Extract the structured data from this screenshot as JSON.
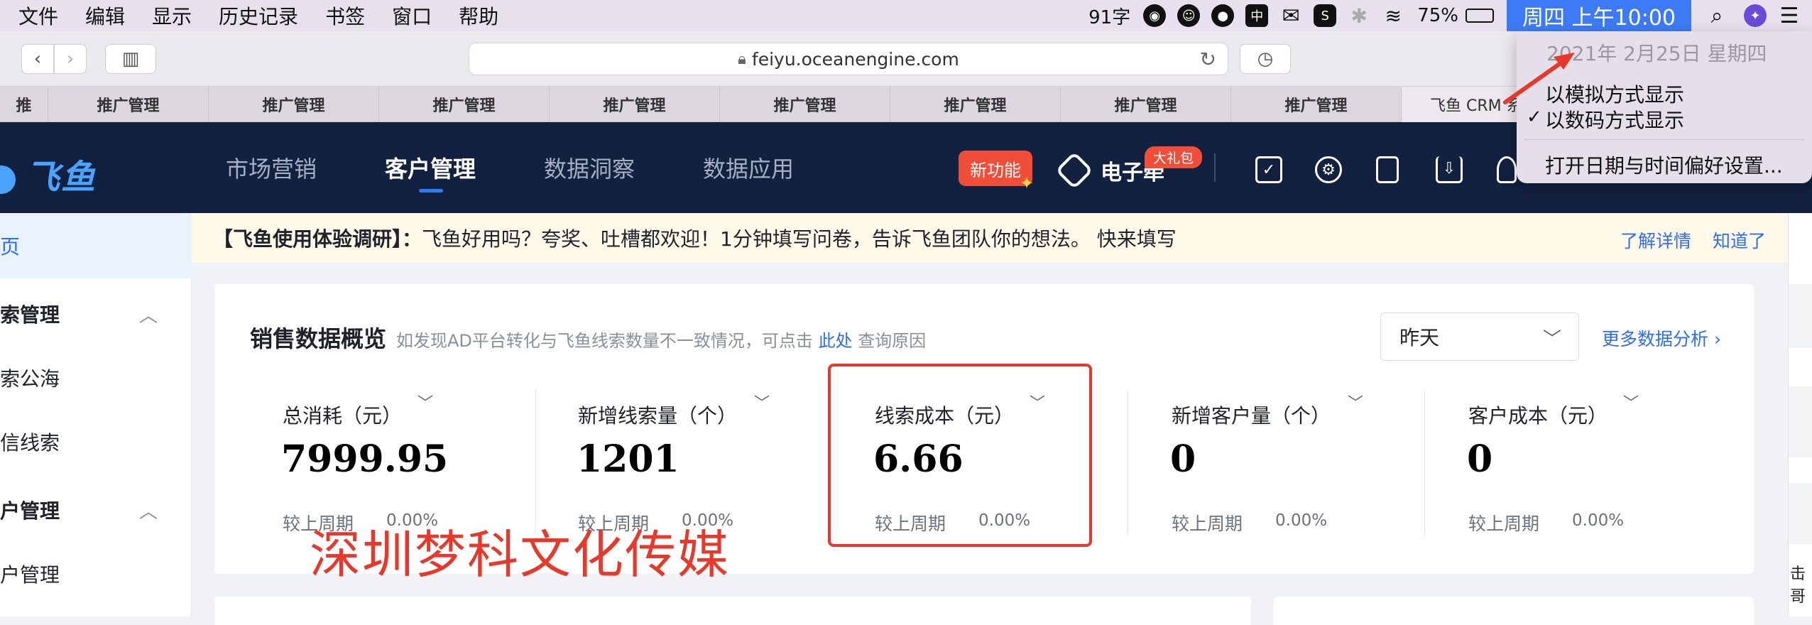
{
  "menubar": {
    "menus": [
      "文件",
      "编辑",
      "显示",
      "历史记录",
      "书签",
      "窗口",
      "帮助"
    ],
    "word_count": "91字",
    "battery": "75%",
    "clock": "周四 上午10:00"
  },
  "browser": {
    "url": "feiyu.oceanengine.com",
    "tabs": [
      "推",
      "推广管理",
      "推广管理",
      "推广管理",
      "推广管理",
      "推广管理",
      "推广管理",
      "推广管理",
      "推广管理",
      "飞鱼 CRM 系"
    ]
  },
  "header": {
    "logo": "飞鱼",
    "nav": [
      "市场营销",
      "客户管理",
      "数据洞察",
      "数据应用"
    ],
    "new_feature": "新功能",
    "esign": "电子牵",
    "gift_badge": "大礼包",
    "icons": [
      "clipboard-icon",
      "gear-icon",
      "tablet-icon",
      "download-icon",
      "bell-icon"
    ]
  },
  "sidebar": {
    "home": "页",
    "items": [
      {
        "label": "索管理",
        "group": true
      },
      {
        "label": "索公海",
        "group": false
      },
      {
        "label": "信线索",
        "group": false
      },
      {
        "label": "户管理",
        "group": true
      },
      {
        "label": "户管理",
        "group": false
      }
    ]
  },
  "notice": {
    "title": "【飞鱼使用体验调研】：",
    "text": "飞鱼好用吗？夸奖、吐槽都欢迎！1分钟填写问卷，告诉飞鱼团队你的想法。 快来填写",
    "learn_more": "了解详情",
    "got_it": "知道了"
  },
  "sales_overview": {
    "title": "销售数据概览",
    "hint_prefix": "如发现AD平台转化与飞鱼线索数量不一致情况，可点击",
    "hint_link": "此处",
    "hint_suffix": "查询原因",
    "period_select": "昨天",
    "more_analysis": "更多数据分析",
    "metrics": [
      {
        "label": "总消耗（元）",
        "value": "7999.95",
        "compare": "较上周期",
        "pct": "0.00%"
      },
      {
        "label": "新增线索量（个）",
        "value": "1201",
        "compare": "较上周期",
        "pct": "0.00%"
      },
      {
        "label": "线索成本（元）",
        "value": "6.66",
        "compare": "较上周期",
        "pct": "0.00%"
      },
      {
        "label": "新增客户量（个）",
        "value": "0",
        "compare": "较上周期",
        "pct": "0.00%"
      },
      {
        "label": "客户成本（元）",
        "value": "0",
        "compare": "较上周期",
        "pct": "0.00%"
      }
    ]
  },
  "watermark": "深圳梦科文化传媒",
  "edge_text": "击哥",
  "date_menu": {
    "date": "2021年 2月25日 星期四",
    "analog": "以模拟方式显示",
    "digital": "以数码方式显示",
    "open_prefs": "打开日期与时间偏好设置..."
  },
  "colors": {
    "header_bg": "#12213f",
    "accent": "#2d6cf6",
    "highlight_red": "#e8382c",
    "new_feature_red": "#f14e3a"
  }
}
